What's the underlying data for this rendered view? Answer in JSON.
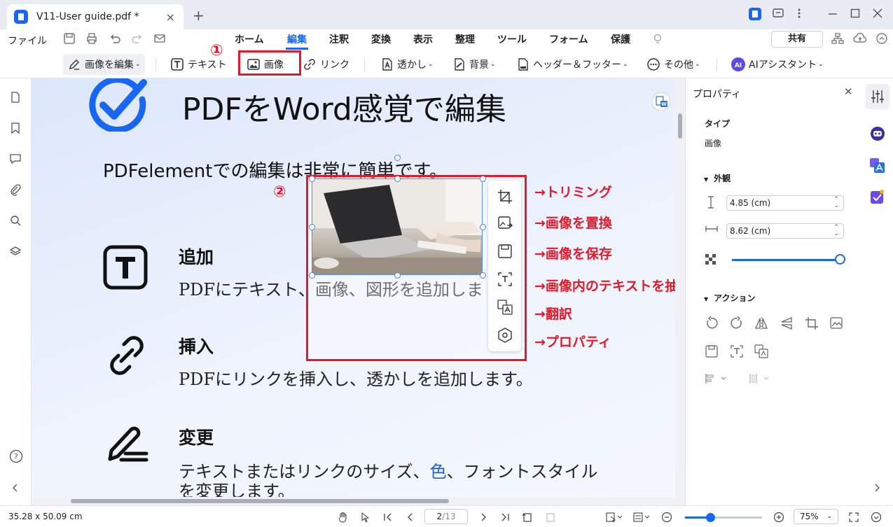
{
  "window": {
    "tab_title": "V11-User guide.pdf *",
    "new_tab": "+",
    "close_tab": "×"
  },
  "menu": {
    "file": "ファイル"
  },
  "nav_tabs": [
    {
      "label": "ホーム"
    },
    {
      "label": "編集"
    },
    {
      "label": "注釈"
    },
    {
      "label": "変換"
    },
    {
      "label": "表示"
    },
    {
      "label": "整理"
    },
    {
      "label": "ツール"
    },
    {
      "label": "フォーム"
    },
    {
      "label": "保護"
    }
  ],
  "share_label": "共有",
  "toolbar": {
    "edit_image": "画像を編集",
    "text": "テキスト",
    "image": "画像",
    "link": "リンク",
    "watermark": "透かし",
    "background": "背景",
    "header_footer": "ヘッダー＆フッター",
    "other": "その他",
    "ai_assistant": "AIアシスタント"
  },
  "annotations": {
    "step1": "①",
    "step2": "②"
  },
  "document": {
    "title": "PDFをWord感覚で編集",
    "intro": "PDFelementでの編集は非常に簡単です。",
    "sections": [
      {
        "heading": "追加",
        "body": "PDFにテキスト、画像、図形を追加しま"
      },
      {
        "heading": "挿入",
        "body": "PDFにリンクを挿入し、透かしを追加します。"
      },
      {
        "heading": "変更",
        "body_a": "テキストまたはリンクのサイズ、",
        "body_color": "色",
        "body_b": "、フォントスタイル",
        "body_line2": "を変更します。"
      }
    ]
  },
  "image_tools": [
    {
      "name": "crop",
      "callout": "→トリミング"
    },
    {
      "name": "replace",
      "callout": "→画像を置換"
    },
    {
      "name": "save",
      "callout": "→画像を保存"
    },
    {
      "name": "extract-text",
      "callout": "→画像内のテキストを抽出"
    },
    {
      "name": "translate",
      "callout": "→翻訳"
    },
    {
      "name": "properties",
      "callout": "→プロパティ"
    }
  ],
  "properties": {
    "title": "プロパティ",
    "type_label": "タイプ",
    "type_value": "画像",
    "appearance": "外観",
    "height": "4.85 (cm)",
    "width": "8.62 (cm)",
    "opacity": 1.0,
    "actions": "アクション"
  },
  "status": {
    "page_size": "35.28 x 50.09 cm",
    "current_page": "2",
    "total_pages": "/13",
    "zoom": "75%",
    "zoom_level": 0.33
  },
  "colors": {
    "accent": "#1867f2",
    "annotation_red": "#e3192a"
  }
}
